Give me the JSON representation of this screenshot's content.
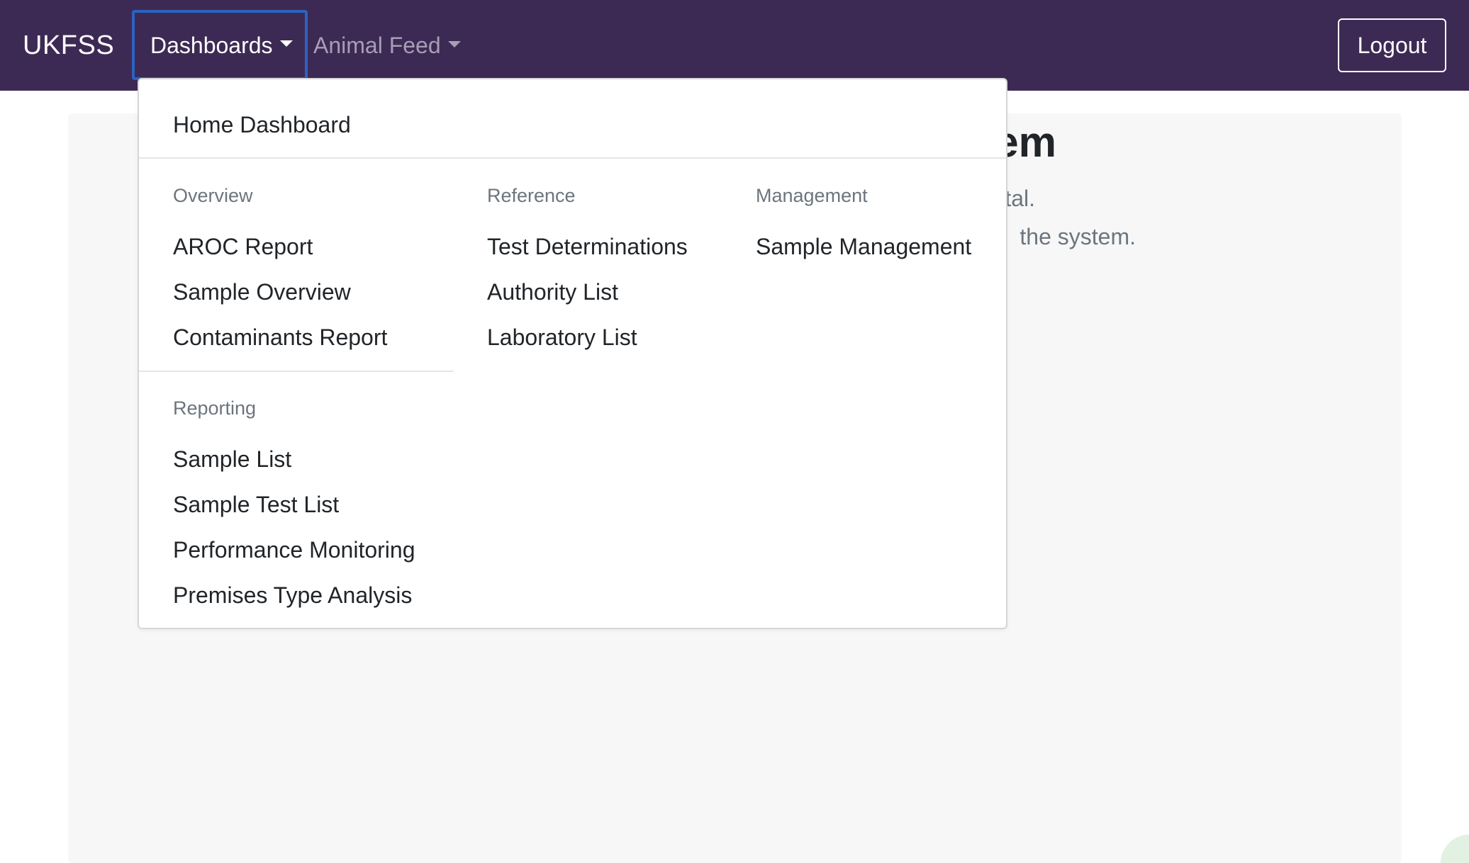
{
  "navbar": {
    "brand": "UKFSS",
    "dashboards_label": "Dashboards",
    "animal_feed_label": "Animal Feed",
    "logout_label": "Logout",
    "background_color": "#3d2a54",
    "active_outline_color": "#2a63c2"
  },
  "hero": {
    "title_fragment": "em",
    "lead_fragment": "tal.",
    "lead_fragment_2": "the system."
  },
  "dropdown": {
    "home_item": "Home Dashboard",
    "overview": {
      "header": "Overview",
      "items": [
        "AROC Report",
        "Sample Overview",
        "Contaminants Report"
      ]
    },
    "reference": {
      "header": "Reference",
      "items": [
        "Test Determinations",
        "Authority List",
        "Laboratory List"
      ]
    },
    "management": {
      "header": "Management",
      "items": [
        "Sample Management"
      ]
    },
    "reporting": {
      "header": "Reporting",
      "items": [
        "Sample List",
        "Sample Test List",
        "Performance Monitoring",
        "Premises Type Analysis"
      ]
    }
  },
  "icons": {
    "dashboards_toggle": "caret-down-icon",
    "animal_feed_toggle": "caret-down-icon"
  }
}
